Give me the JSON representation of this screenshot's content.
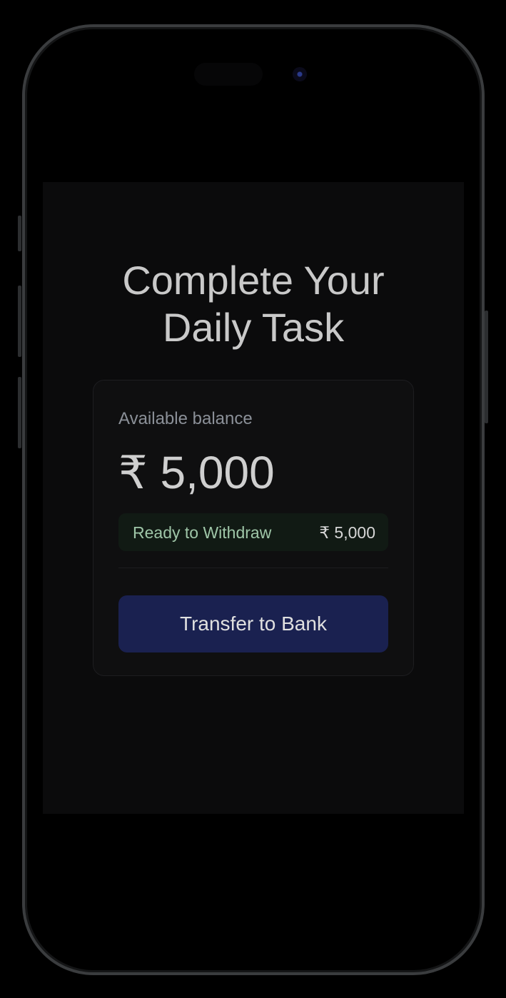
{
  "title": {
    "line1": "Complete Your",
    "line2": "Daily Task"
  },
  "card": {
    "balance_label": "Available balance",
    "balance_amount": "₹ 5,000",
    "withdraw_label": "Ready to Withdraw",
    "withdraw_amount": "₹ 5,000",
    "transfer_button": "Transfer to Bank"
  },
  "colors": {
    "accent_button": "#1a2150",
    "withdraw_text": "#9fc6a8",
    "background": "#0b0b0c"
  }
}
